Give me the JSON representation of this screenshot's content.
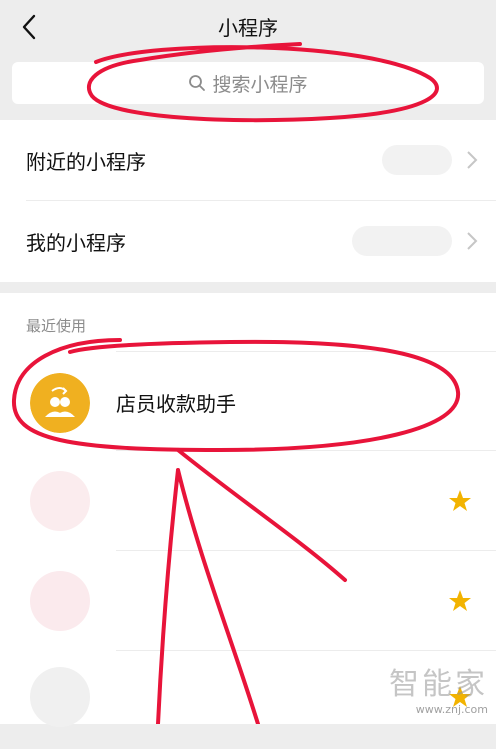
{
  "header": {
    "title": "小程序"
  },
  "search": {
    "placeholder": "搜索小程序"
  },
  "menu": {
    "nearby": "附近的小程序",
    "mine": "我的小程序"
  },
  "recent": {
    "label": "最近使用",
    "apps": [
      {
        "name": "店员收款助手",
        "icon": "two-people-arrow-icon",
        "icon_color": "#f0b020"
      },
      {
        "name": "",
        "icon": "blurred-app-icon",
        "starred": true
      },
      {
        "name": "",
        "icon": "blurred-app-icon",
        "starred": true
      },
      {
        "name": "",
        "icon": "blurred-app-icon",
        "starred": true
      }
    ]
  },
  "watermark": {
    "text": "智能家",
    "url": "www.znj.com"
  },
  "colors": {
    "annotation_red": "#e8143a",
    "star_yellow": "#f2b300",
    "brand_icon": "#f0b020"
  }
}
